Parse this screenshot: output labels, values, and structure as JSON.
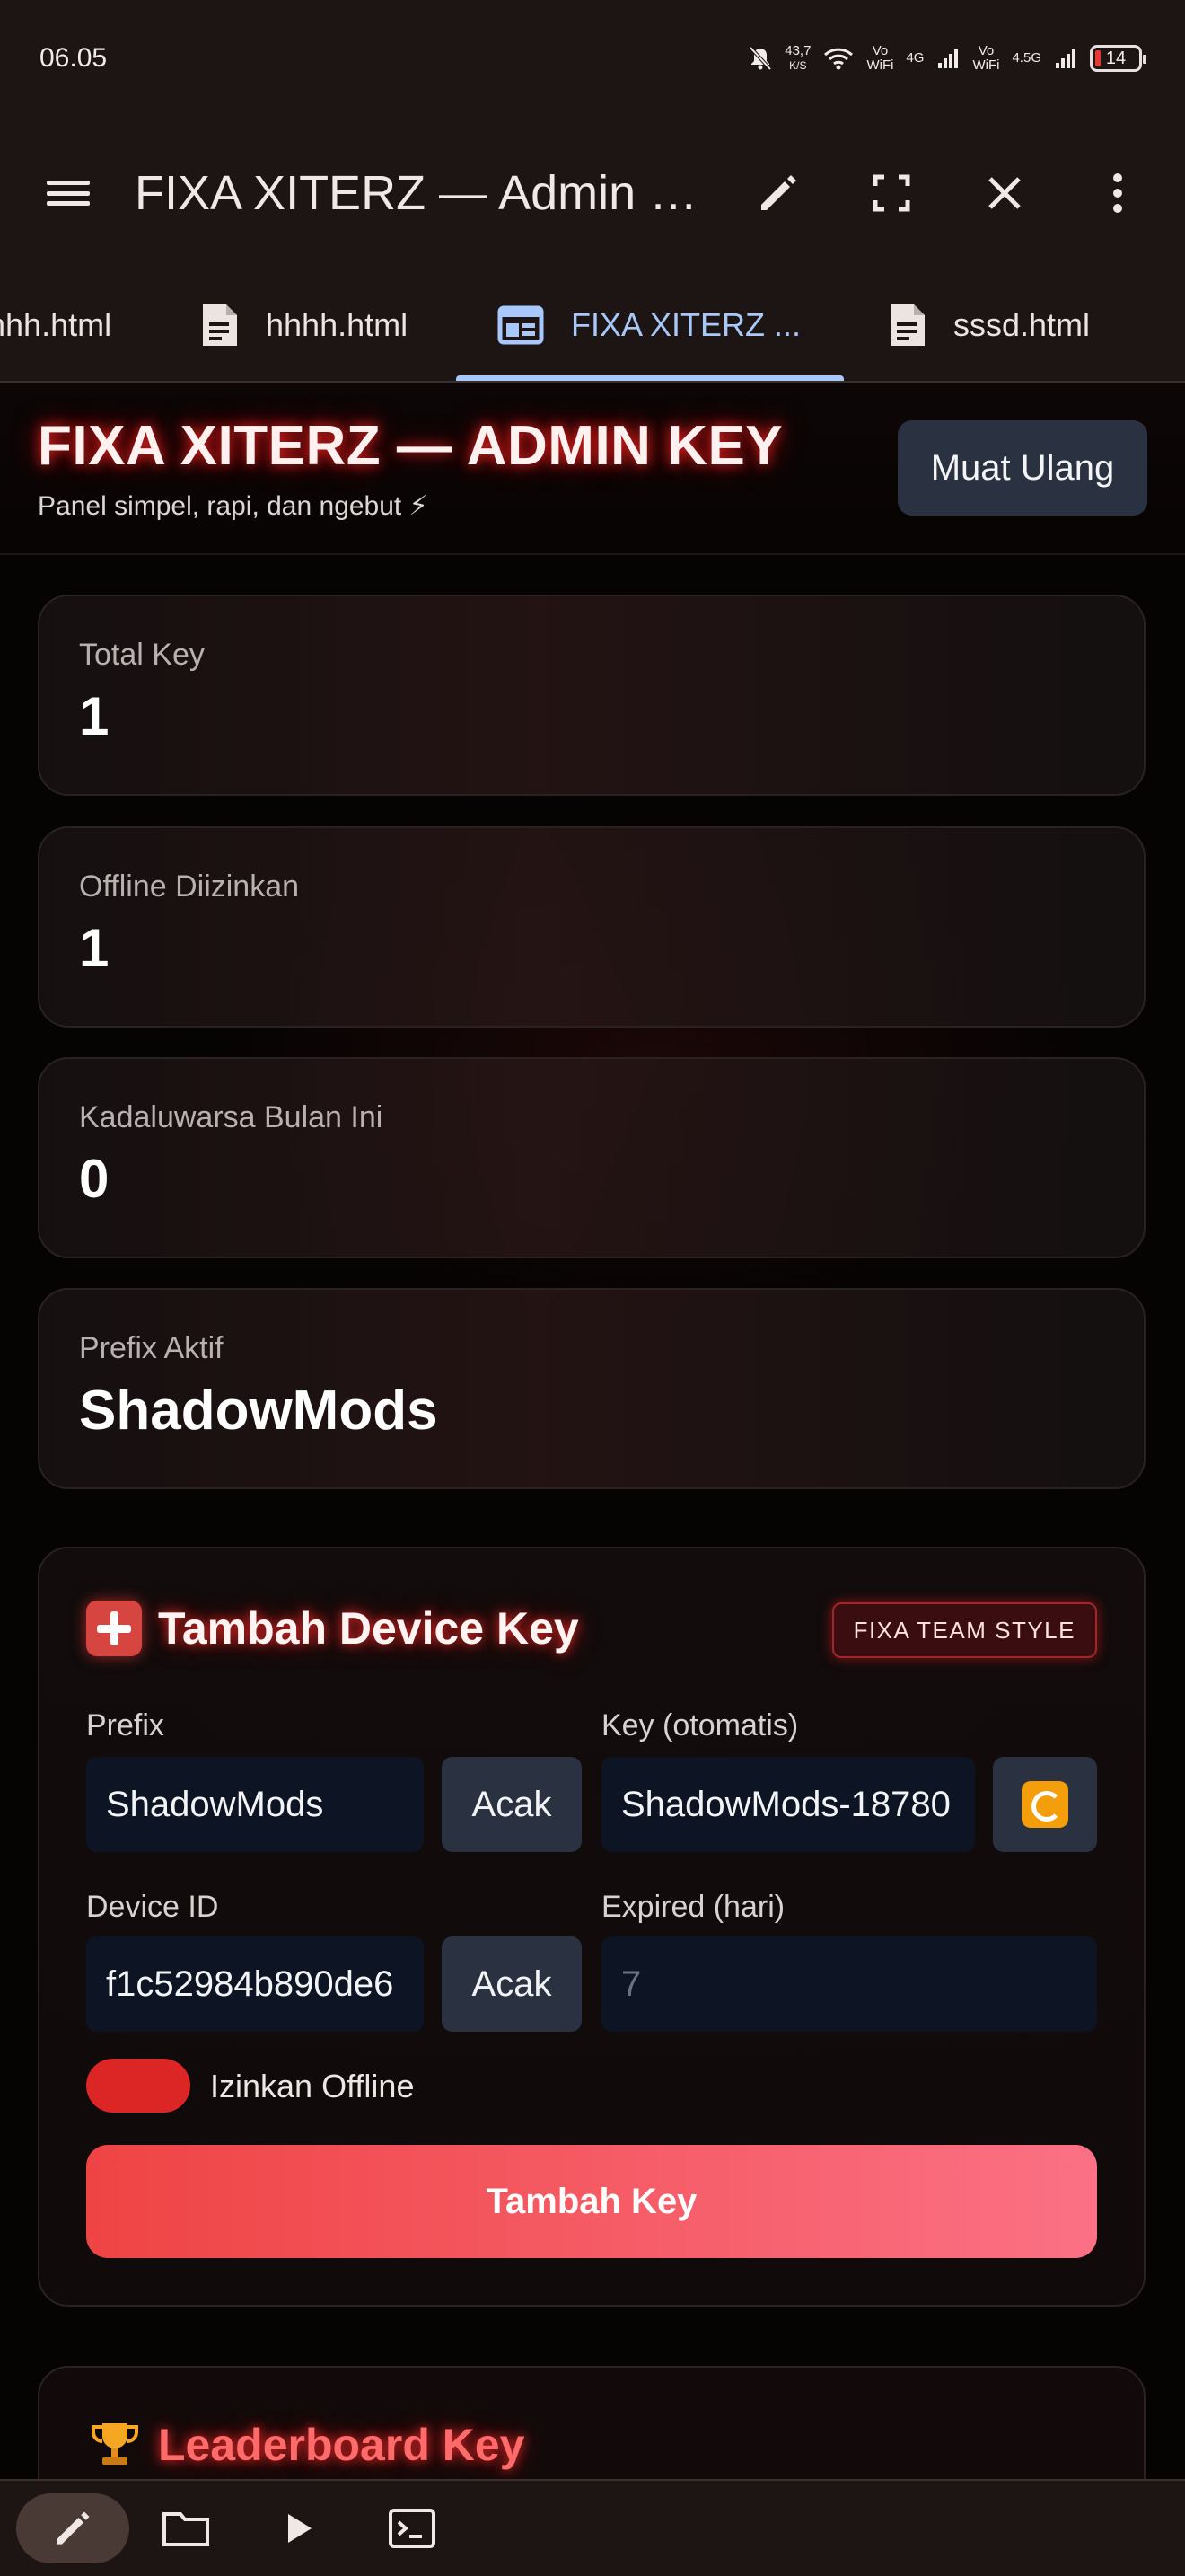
{
  "status_bar": {
    "time": "06.05",
    "speed_value": "43,7",
    "speed_unit": "K/S",
    "vowifi_1": "Vo WiFi",
    "net_4g": "4G",
    "vowifi_2": "Vo WiFi",
    "net_45g": "4.5G",
    "battery": "14"
  },
  "app_bar": {
    "title": "FIXA XITERZ — Admin Key",
    "icons": [
      "menu-icon",
      "pencil-icon",
      "fullscreen-icon",
      "close-icon",
      "more-vert-icon"
    ]
  },
  "tabs": [
    {
      "label": "hhh.html",
      "icon": "document-icon"
    },
    {
      "label": "hhhh.html",
      "icon": "document-icon"
    },
    {
      "label": "FIXA XITERZ ...",
      "icon": "browser-window-icon",
      "active": true
    },
    {
      "label": "sssd.html",
      "icon": "document-icon"
    }
  ],
  "header": {
    "title": "FIXA XITERZ — ADMIN KEY",
    "subtitle": "Panel simpel, rapi, dan ngebut ⚡",
    "reload_label": "Muat Ulang"
  },
  "stats": [
    {
      "label": "Total Key",
      "value": "1"
    },
    {
      "label": "Offline Diizinkan",
      "value": "1"
    },
    {
      "label": "Kadaluwarsa Bulan Ini",
      "value": "0"
    },
    {
      "label": "Prefix Aktif",
      "value": "ShadowMods"
    }
  ],
  "form": {
    "heading": "Tambah Device Key",
    "badge": "FIXA TEAM STYLE",
    "prefix_label": "Prefix",
    "prefix_value": "ShadowMods",
    "random_label": "Acak",
    "key_label": "Key (otomatis)",
    "key_value": "ShadowMods-18780",
    "device_label": "Device ID",
    "device_value": "f1c52984b890de6",
    "expired_label": "Expired (hari)",
    "expired_placeholder": "7",
    "offline_label": "Izinkan Offline",
    "offline_enabled": true,
    "submit_label": "Tambah Key"
  },
  "leaderboard": {
    "heading": "Leaderboard Key"
  },
  "bottom_toolbar": {
    "icons": [
      "pencil-icon",
      "folder-icon",
      "play-icon",
      "terminal-icon"
    ],
    "active": "pencil-icon"
  },
  "colors": {
    "accent_red": "#ef4444",
    "tab_active": "#a8c7fa",
    "button_gray": "#2a3140",
    "input_bg": "#0d1525"
  }
}
